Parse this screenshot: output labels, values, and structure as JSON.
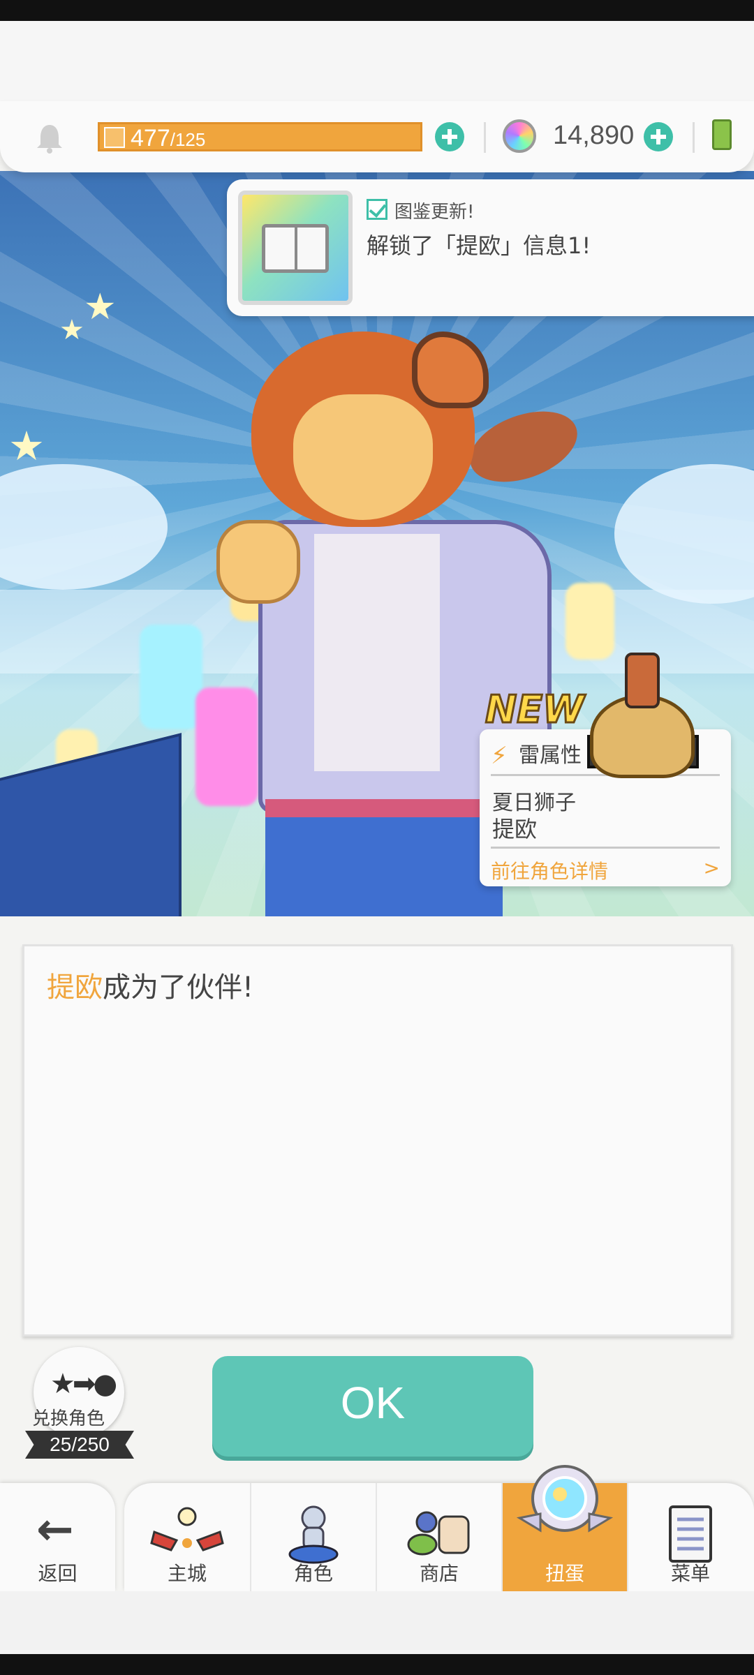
{
  "hud": {
    "stamina_current": "477",
    "stamina_max": "/125",
    "gems": "14,890"
  },
  "toast": {
    "title": "图鉴更新!",
    "message": "解锁了「提欧」信息1!"
  },
  "new_badge": "NEW",
  "character_card": {
    "element": "雷属性",
    "rarity_stars": "★★★★★",
    "title": "夏日狮子",
    "name": "提欧",
    "detail_link": "前往角色详情",
    "detail_arrow": ">"
  },
  "dialog": {
    "highlight": "提欧",
    "text": "成为了伙伴!"
  },
  "swap": {
    "label": "兑换角色",
    "count": "25/250"
  },
  "ok_label": "OK",
  "nav": {
    "back": "返回",
    "items": [
      {
        "label": "主城",
        "icon": "castle-icon"
      },
      {
        "label": "角色",
        "icon": "character-icon"
      },
      {
        "label": "商店",
        "icon": "shop-icon"
      },
      {
        "label": "扭蛋",
        "icon": "gacha-icon",
        "active": true
      },
      {
        "label": "菜单",
        "icon": "menu-icon"
      }
    ]
  },
  "colors": {
    "accent": "#f0a53d",
    "teal": "#5ec6b6"
  }
}
